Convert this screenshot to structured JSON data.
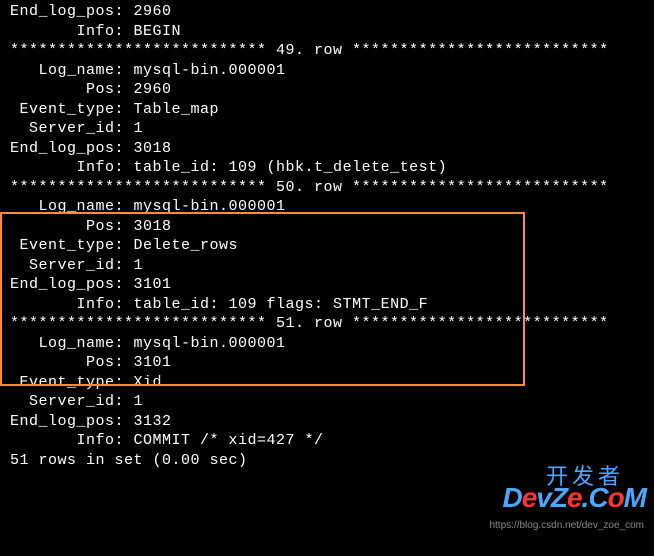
{
  "row48_tail": {
    "end_log_pos": "2960",
    "info": "BEGIN"
  },
  "sep49": "*************************** 49. row ***************************",
  "row49": {
    "log_name": "mysql-bin.000001",
    "pos": "2960",
    "event_type": "Table_map",
    "server_id": "1",
    "end_log_pos": "3018",
    "info": "table_id: 109 (hbk.t_delete_test)"
  },
  "sep50": "*************************** 50. row ***************************",
  "row50": {
    "log_name": "mysql-bin.000001",
    "pos": "3018",
    "event_type": "Delete_rows",
    "server_id": "1",
    "end_log_pos": "3101",
    "info": "table_id: 109 flags: STMT_END_F"
  },
  "sep51": "*************************** 51. row ***************************",
  "row51": {
    "log_name": "mysql-bin.000001",
    "pos": "3101",
    "event_type": "Xid",
    "server_id": "1",
    "end_log_pos": "3132",
    "info": "COMMIT /* xid=427 */"
  },
  "footer": "51 rows in set (0.00 sec)",
  "labels": {
    "log_name": "   Log_name: ",
    "pos": "        Pos: ",
    "event_type": " Event_type: ",
    "server_id": "  Server_id: ",
    "end_log_pos": "End_log_pos: ",
    "info": "       Info: "
  },
  "watermark": {
    "top": "开发者",
    "text_pre": "D",
    "text_e1": "e",
    "text_v": "v",
    "text_z": "Z",
    "text_e2": "e",
    "text_dot": ".",
    "text_c": "C",
    "text_o": "o",
    "text_m": "M",
    "url": "https://blog.csdn.net/dev_zoe_com"
  }
}
